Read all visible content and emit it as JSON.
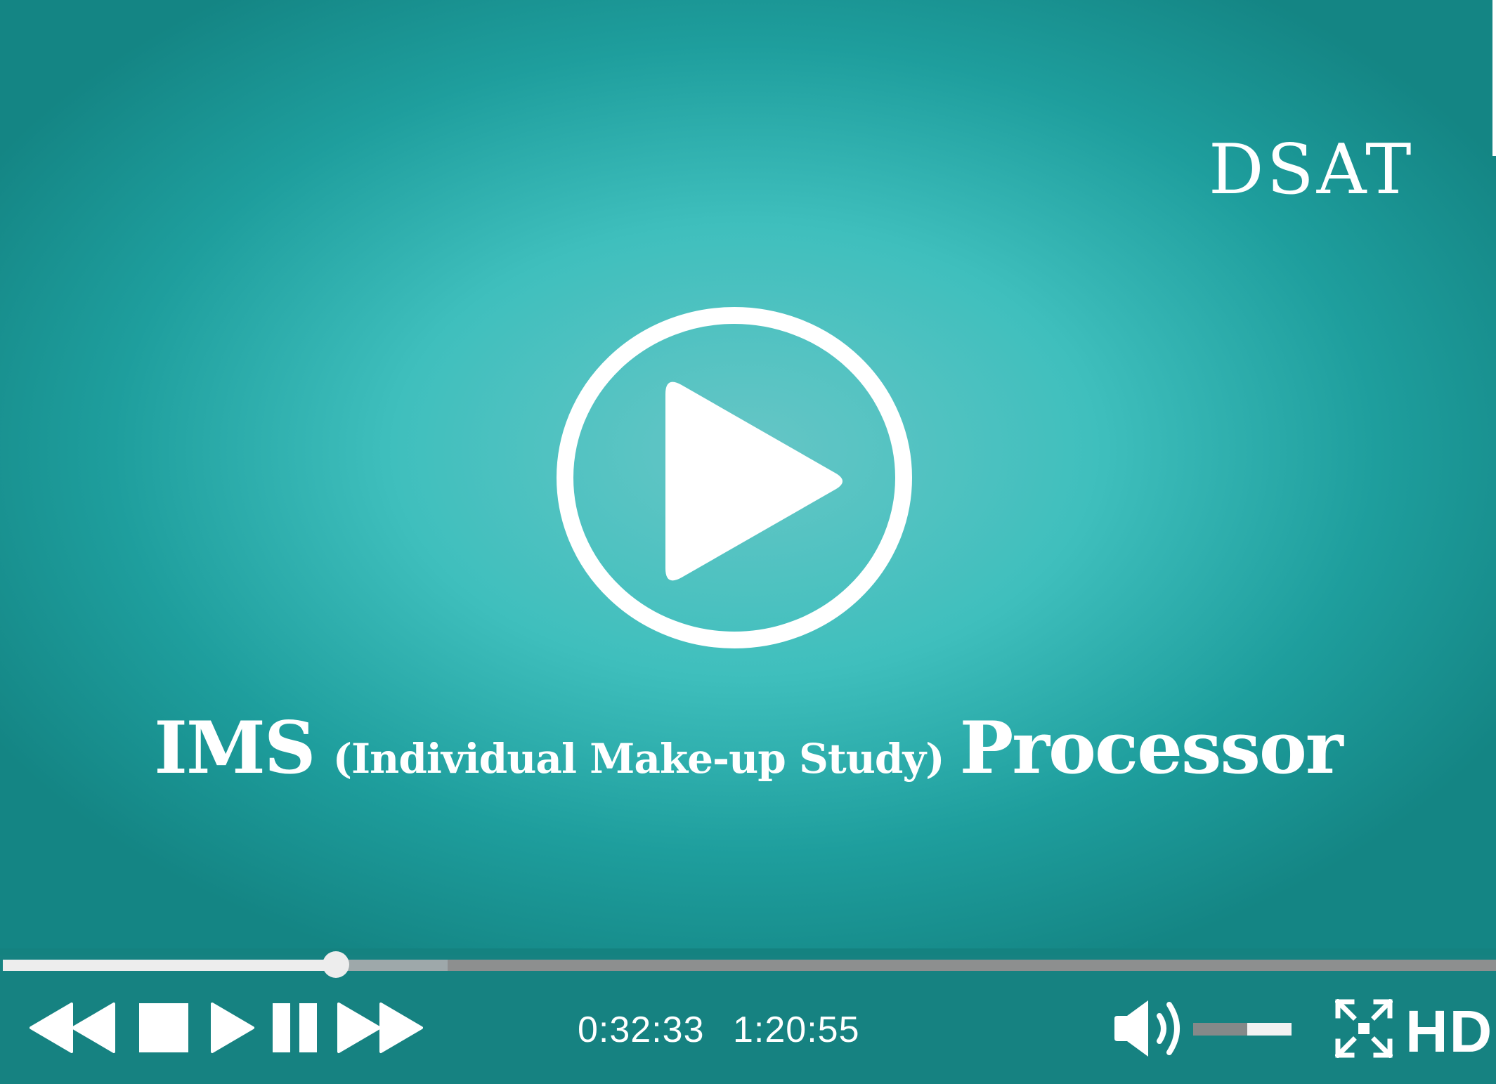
{
  "brand": {
    "text": "DSAT"
  },
  "headline": {
    "prefix": "IMS",
    "middle": "(Individual Make-up Study)",
    "suffix": "Processor"
  },
  "playback": {
    "current_time": "0:32:33",
    "total_time": "1:20:55",
    "progress": 0.223,
    "buffered": 0.298
  },
  "volume": {
    "level": 0.55
  },
  "quality": {
    "label": "HD"
  },
  "controls": {
    "icons": [
      "rewind-icon",
      "stop-icon",
      "play-icon",
      "pause-icon",
      "fast-forward-icon",
      "volume-icon",
      "fullscreen-icon"
    ]
  },
  "colors": {
    "accent": "#168281",
    "center_glow": "#66c6c6",
    "white": "#ffffff",
    "seek_played": "#ededed",
    "seek_buffered": "#9ea8aa",
    "seek_remaining": "#8d8f8f"
  }
}
